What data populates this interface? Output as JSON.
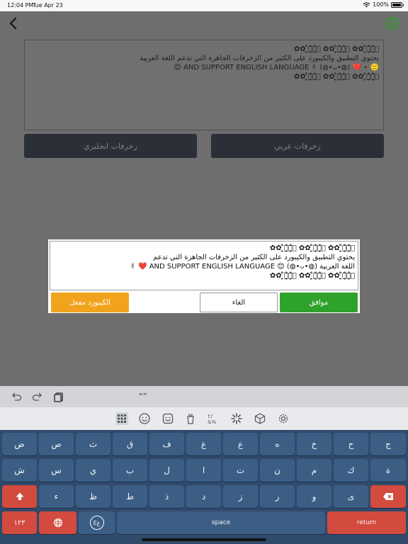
{
  "status_bar": {
    "time": "12:04 PM",
    "date": "Tue Apr 23",
    "battery": "100%"
  },
  "nav": {
    "back_icon": "chevron-left-icon",
    "done_icon": "check-circle-icon",
    "done_color": "#2fa22c"
  },
  "editor": {
    "lines": [
      "۞̤̥̈̊۞̤̥̈̊۞̤̥̈̊ ✿✿ ۞̤̥̈̊۞̤̥̈̊۞̤̥̈̊ ✿✿ ۞̤̥̈̊۞̤̥̈̊۞̤̥̈̊ ✿✿",
      "يحتوي التطبيق والكيبورد على الكثير من الزخرفات الجاهزة التي تدعم اللغة العربية",
      "🙂 ⋆ ❤️ (◍•ᴗ•◍) ✌ AND SUPPORT ENGLISH LANGUAGE 😊",
      "۞̤̥̈̊۞̤̥̈̊۞̤̥̈̊ ✿✿ ۞̤̥̈̊۞̤̥̈̊۞̤̥̈̊ ✿✿ ۞̤̥̈̊۞̤̥̈̊۞̤̥̈̊ ✿✿"
    ]
  },
  "buttons": {
    "english": "زخرفات انجليزي",
    "arabic": "زخرفات عربي"
  },
  "dialog": {
    "lines": [
      "۞̤̥̈̊۞̤̥̈̊۞̤̥̈̊ ✿✿ ۞̤̥̈̊۞̤̥̈̊۞̤̥̈̊ ✿✿ ۞̤̥̈̊۞̤̥̈̊۞̤̥̈̊ ✿✿",
      "يحتوي التطبيق والكيبورد على الكثير من الزخرفات الجاهزة التي تدعم",
      "اللغة العربية AND SUPPORT ENGLISH LANGUAGE 😊 (◍•ᴗ•◍) ❤️ ✌",
      "۞̤̥̈̊۞̤̥̈̊۞̤̥̈̊ ✿✿ ۞̤̥̈̊۞̤̥̈̊۞̤̥̈̊ ✿✿ ۞̤̥̈̊۞̤̥̈̊۞̤̥̈̊ ✿✿"
    ],
    "ok": "موافق",
    "cancel": "الغاء",
    "keyboard_enabled": "الكيبورد مفعل"
  },
  "toolbar": {
    "quote": "“”"
  },
  "keyboard": {
    "rows": [
      [
        "ض",
        "ص",
        "ث",
        "ق",
        "ف",
        "غ",
        "ع",
        "ه",
        "خ",
        "ح",
        "ج"
      ],
      [
        "ش",
        "س",
        "ي",
        "ب",
        "ل",
        "ا",
        "ت",
        "ن",
        "م",
        "ك",
        "ة"
      ],
      [
        "ء",
        "ظ",
        "ط",
        "ذ",
        "د",
        "ز",
        "ر",
        "و",
        "ى"
      ]
    ],
    "numbers": "١٢٣",
    "lang_key": "Eغ",
    "space": "space",
    "return": "return"
  }
}
